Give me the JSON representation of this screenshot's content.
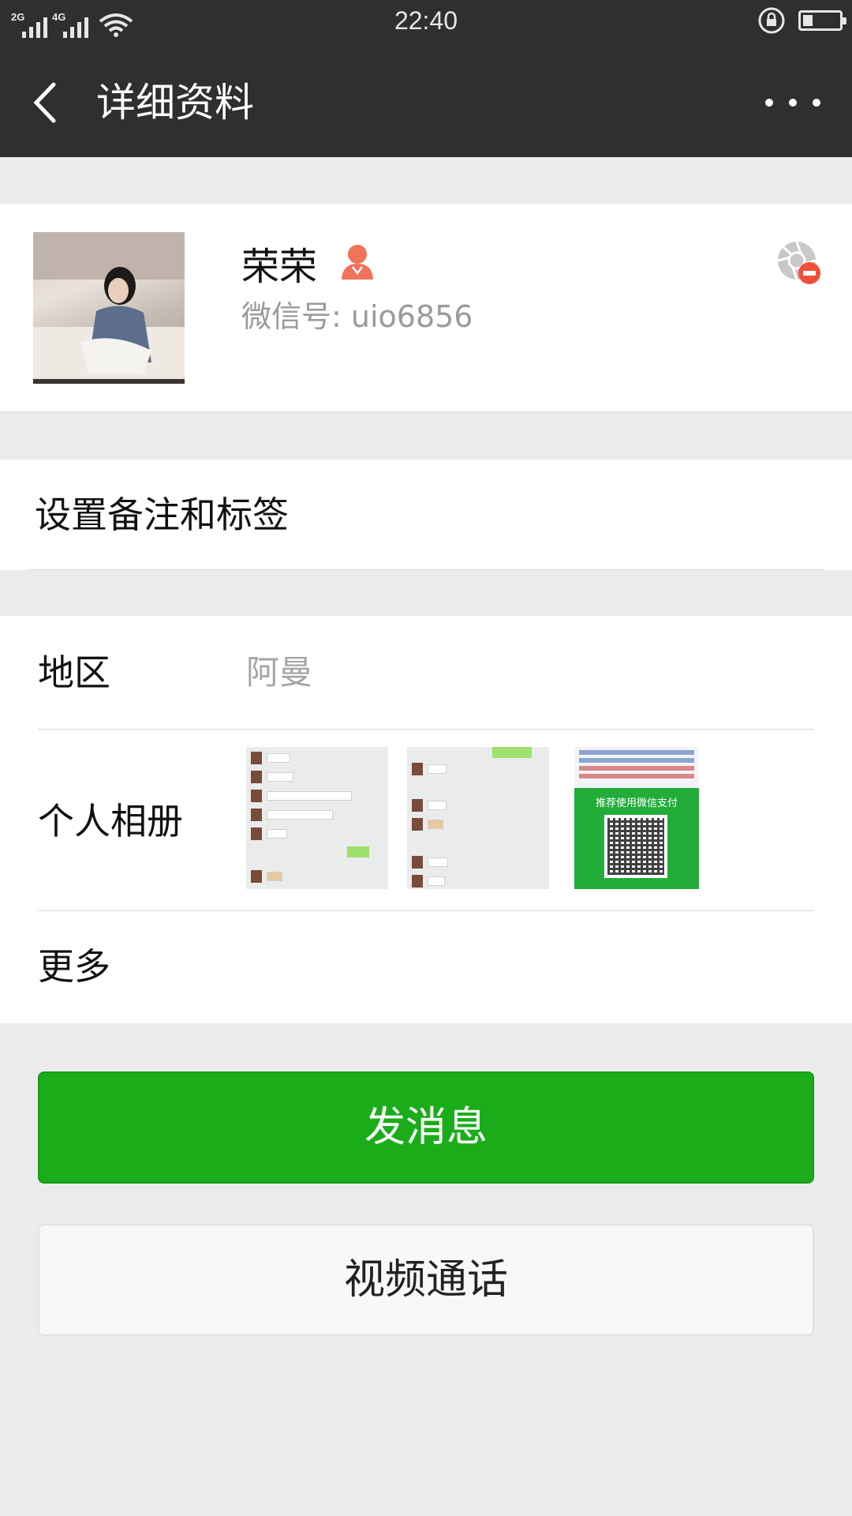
{
  "status_bar": {
    "network_1": "2G",
    "network_2": "4G",
    "time": "22:40",
    "icons": [
      "signal-icon",
      "signal-icon",
      "wifi-icon",
      "rotation-lock-icon",
      "battery-icon"
    ]
  },
  "header": {
    "title": "详细资料",
    "back_icon": "chevron-left-icon",
    "more_icon": "more-dots-icon"
  },
  "profile": {
    "name": "荣荣",
    "gender_icon": "female-icon",
    "gender_color": "#f0735a",
    "wechat_id": "微信号: uio6856",
    "moments_icon": "moments-blocked-icon"
  },
  "remark": {
    "label": "设置备注和标签"
  },
  "info": {
    "region_label": "地区",
    "region_value": "阿曼",
    "album_label": "个人相册",
    "album_thumbs": [
      "chat-screenshot-thumb",
      "chat-screenshot-thumb",
      "wechat-pay-qr-thumb"
    ],
    "album_pay_text": "推荐使用微信支付",
    "more_label": "更多"
  },
  "actions": {
    "send_message": "发消息",
    "video_call": "视频通话"
  },
  "colors": {
    "header_bg": "#2f2f2f",
    "primary_green": "#1aad19",
    "page_bg": "#ebebeb"
  }
}
